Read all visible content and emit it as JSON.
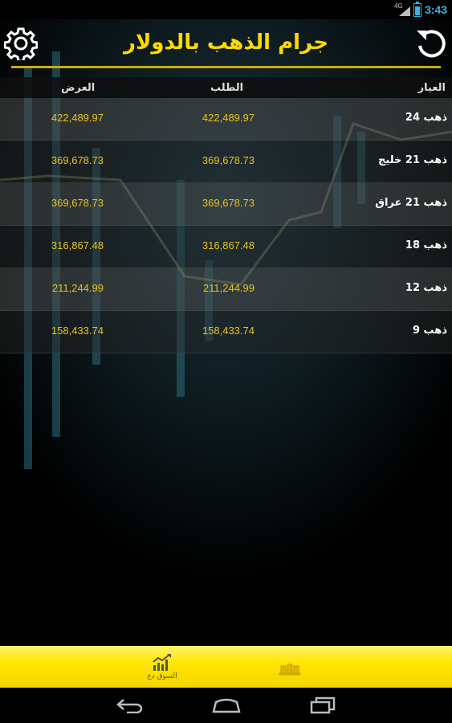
{
  "status_bar": {
    "network": "4G",
    "time": "3:43",
    "battery_level": 0.85
  },
  "header": {
    "title": "جرام الذهب بالدولار",
    "settings_icon": "gear-icon",
    "refresh_icon": "refresh-icon"
  },
  "table": {
    "columns": {
      "karat": "العيار",
      "bid": "الطلب",
      "ask": "العرض"
    },
    "rows": [
      {
        "name": "ذهب 24",
        "bid": "422,489.97",
        "ask": "422,489.97"
      },
      {
        "name": "ذهب 21 خليج",
        "bid": "369,678.73",
        "ask": "369,678.73"
      },
      {
        "name": "ذهب 21 عراق",
        "bid": "369,678.73",
        "ask": "369,678.73"
      },
      {
        "name": "ذهب 18",
        "bid": "316,867.48",
        "ask": "316,867.48"
      },
      {
        "name": "ذهب 12",
        "bid": "211,244.99",
        "ask": "211,244.99"
      },
      {
        "name": "ذهب 9",
        "bid": "158,433.74",
        "ask": "158,433.74"
      }
    ]
  },
  "bottom_tabs": [
    {
      "label": "السوق دع",
      "icon": "chart-icon",
      "active": false
    },
    {
      "label": "",
      "icon": "gold-bars-icon",
      "active": true
    }
  ],
  "nav_bar": {
    "back_icon": "back-icon",
    "home_icon": "home-icon",
    "recent_icon": "recent-apps-icon"
  },
  "colors": {
    "accent": "#ffd900",
    "value_text": "#e8c419",
    "status_blue": "#33b5e5",
    "tab_bar": "#ffe600"
  }
}
